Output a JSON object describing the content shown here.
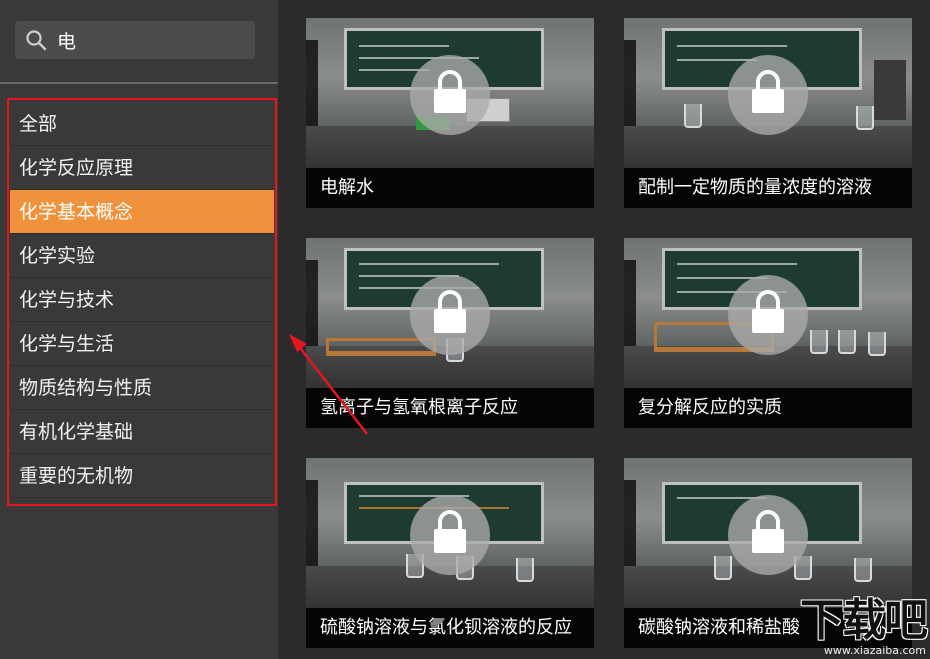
{
  "search": {
    "query": "电",
    "icon": "search-icon"
  },
  "sidebar": {
    "items": [
      {
        "label": "全部",
        "active": false
      },
      {
        "label": "化学反应原理",
        "active": false
      },
      {
        "label": "化学基本概念",
        "active": true
      },
      {
        "label": "化学实验",
        "active": false
      },
      {
        "label": "化学与技术",
        "active": false
      },
      {
        "label": "化学与生活",
        "active": false
      },
      {
        "label": "物质结构与性质",
        "active": false
      },
      {
        "label": "有机化学基础",
        "active": false
      },
      {
        "label": "重要的无机物",
        "active": false
      }
    ],
    "active_color": "#f0923b"
  },
  "cards": [
    {
      "title": "电解水",
      "locked": true
    },
    {
      "title": "配制一定物质的量浓度的溶液",
      "locked": true
    },
    {
      "title": "氢离子与氢氧根离子反应",
      "locked": true
    },
    {
      "title": "复分解反应的实质",
      "locked": true
    },
    {
      "title": "硫酸钠溶液与氯化钡溶液的反应",
      "locked": true
    },
    {
      "title": "碳酸钠溶液和稀盐酸",
      "locked": true
    }
  ],
  "annotation": {
    "highlight_color": "#e8141e"
  },
  "watermark": {
    "main": "下载吧",
    "sub": "www.xiazaiba.com"
  }
}
